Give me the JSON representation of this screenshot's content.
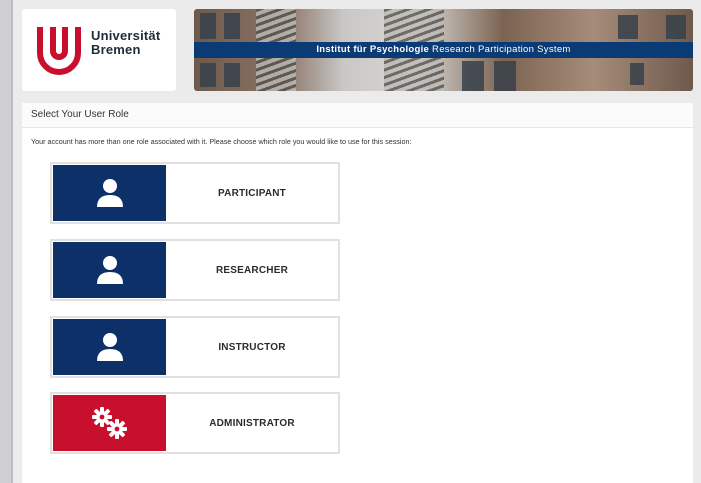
{
  "header": {
    "logo_line1": "Universität",
    "logo_line2": "Bremen",
    "banner_bold": "Institut für Psychologie",
    "banner_rest": " Research Participation System"
  },
  "panel": {
    "title": "Select Your User Role",
    "intro": "Your account has more than one role associated with it. Please choose which role you would like to use for this session:"
  },
  "roles": [
    {
      "label": "PARTICIPANT",
      "icon": "user-icon",
      "color": "#0d3068"
    },
    {
      "label": "RESEARCHER",
      "icon": "user-icon",
      "color": "#0d3068"
    },
    {
      "label": "INSTRUCTOR",
      "icon": "user-icon",
      "color": "#0d3068"
    },
    {
      "label": "ADMINISTRATOR",
      "icon": "gears-icon",
      "color": "#c8102e"
    }
  ]
}
